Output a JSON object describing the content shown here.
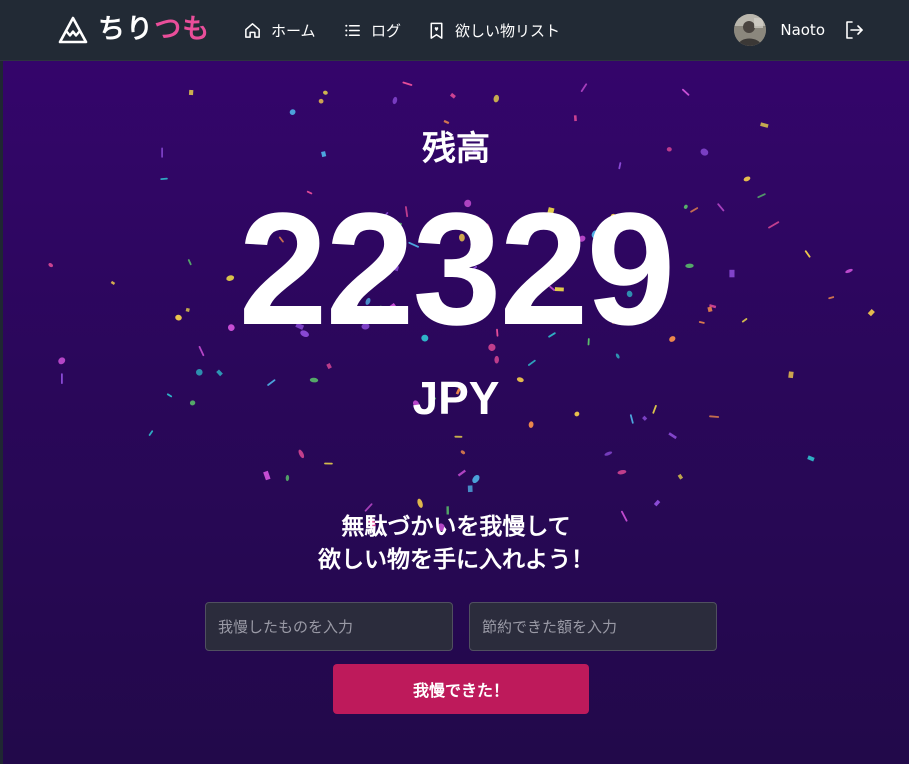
{
  "app": {
    "logo_part1": "ちり",
    "logo_part2": "つも",
    "accent_color": "#e94e9a"
  },
  "nav": {
    "items": [
      {
        "label": "ホーム",
        "icon": "home-icon"
      },
      {
        "label": "ログ",
        "icon": "list-icon"
      },
      {
        "label": "欲しい物リスト",
        "icon": "bookmark-icon"
      }
    ]
  },
  "user": {
    "name": "Naoto",
    "logout_icon": "logout-icon"
  },
  "balance": {
    "label": "残高",
    "amount": "22329",
    "currency": "JPY"
  },
  "message": {
    "line1": "無駄づかいを我慢して",
    "line2": "欲しい物を手に入れよう！"
  },
  "form": {
    "item_placeholder": "我慢したものを入力",
    "amount_placeholder": "節約できた額を入力",
    "submit_label": "我慢できた！",
    "submit_color": "#be1a5b"
  }
}
